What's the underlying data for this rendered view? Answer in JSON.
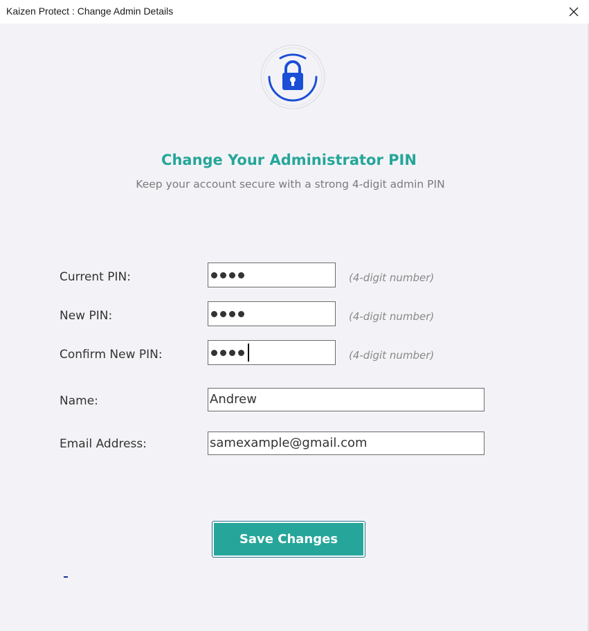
{
  "window": {
    "title": "Kaizen Protect : Change Admin Details",
    "close_icon": "close-icon"
  },
  "header": {
    "icon": "lock-icon",
    "title": "Change Your Administrator PIN",
    "subtitle": "Keep your account secure with a strong 4-digit admin PIN"
  },
  "form": {
    "current_pin": {
      "label": "Current PIN:",
      "masked_length": 4,
      "hint": "(4-digit number)"
    },
    "new_pin": {
      "label": "New PIN:",
      "masked_length": 4,
      "hint": "(4-digit number)"
    },
    "confirm_pin": {
      "label": "Confirm New PIN:",
      "masked_length": 4,
      "hint": "(4-digit number)"
    },
    "name": {
      "label": "Name:",
      "value": "Andrew"
    },
    "email": {
      "label": "Email Address:",
      "value": "samexample@gmail.com"
    }
  },
  "save_button": {
    "label": "Save Changes"
  },
  "status_text": "-",
  "colors": {
    "accent": "#26a69a",
    "lock": "#1a4fd6",
    "background": "#f3f3f7"
  }
}
